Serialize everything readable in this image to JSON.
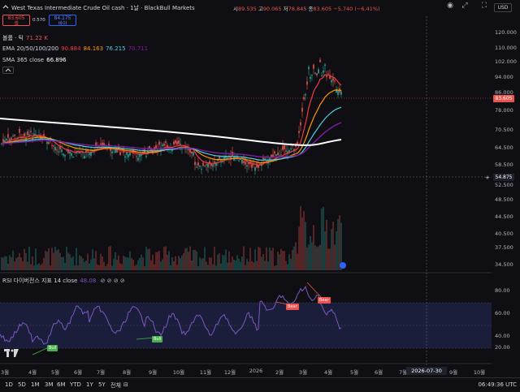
{
  "header": {
    "symbol_title": "West Texas Intermediate Crude Oil cash · 1날 · BlackBull Markets",
    "open_label": "시",
    "open_value": "89.535",
    "high_label": "고",
    "high_value": "90.065",
    "low_label": "저",
    "low_value": "78.845",
    "close_label": "종",
    "close_value": "83.605",
    "change": "−5.740 (−6.41%)"
  },
  "price_buttons": {
    "sell_price": "83.605",
    "sell_label": "셀",
    "spread": "0.570",
    "buy_price": "84.175",
    "buy_label": "바이"
  },
  "indicators": {
    "volume_label": "볼륨 · 틱",
    "volume_value": "71.22 K",
    "ema_label": "EMA 20/50/100/200",
    "ema_values": [
      "90.884",
      "84.163",
      "76.215",
      "70.711"
    ],
    "sma_label": "SMA 365 close",
    "sma_value": "66.896",
    "rsi_label": "RSI 다이버전스 지표 14 close",
    "rsi_value": "48.08"
  },
  "top_right": {
    "currency": "USD"
  },
  "price_axis": {
    "ticks": [
      "120.000",
      "110.000",
      "102.000",
      "94.000",
      "86.000",
      "78.000",
      "70.500",
      "64.500",
      "58.500",
      "52.500",
      "48.500",
      "44.500",
      "40.500",
      "37.500",
      "34.500"
    ],
    "current_price": "83.605",
    "crosshair_price": "54.875"
  },
  "rsi_axis": {
    "ticks": [
      "80.00",
      "60.00",
      "40.00",
      "20.00"
    ]
  },
  "time_axis": {
    "ticks": [
      "3월",
      "4월",
      "5월",
      "6월",
      "7월",
      "8월",
      "9월",
      "10월",
      "11월",
      "12월",
      "2026",
      "2월",
      "3월",
      "4월",
      "5월",
      "6월",
      "7월",
      "8월",
      "9월",
      "10월"
    ],
    "crosshair_date": "2026-07-30"
  },
  "rsi_tags": {
    "bull": "Bull",
    "bear": "Bear"
  },
  "bottom_bar": {
    "timeframes": [
      "1D",
      "5D",
      "1M",
      "3M",
      "6M",
      "YTD",
      "1Y",
      "5Y",
      "전체"
    ],
    "clock": "06:49:36 UTC"
  },
  "colors": {
    "background": "#0f0f13",
    "up": "#26a69a",
    "down": "#ef5350",
    "ema20": "#f23645",
    "ema50": "#ff9800",
    "ema100": "#4dd0e1",
    "ema200": "#7b1fa2",
    "sma365": "#ffffff",
    "rsi": "#7e57c2"
  },
  "icons": [
    "collapse-icon",
    "search-icon",
    "fullscreen-icon",
    "camera-icon",
    "tradingview-logo-icon"
  ]
}
